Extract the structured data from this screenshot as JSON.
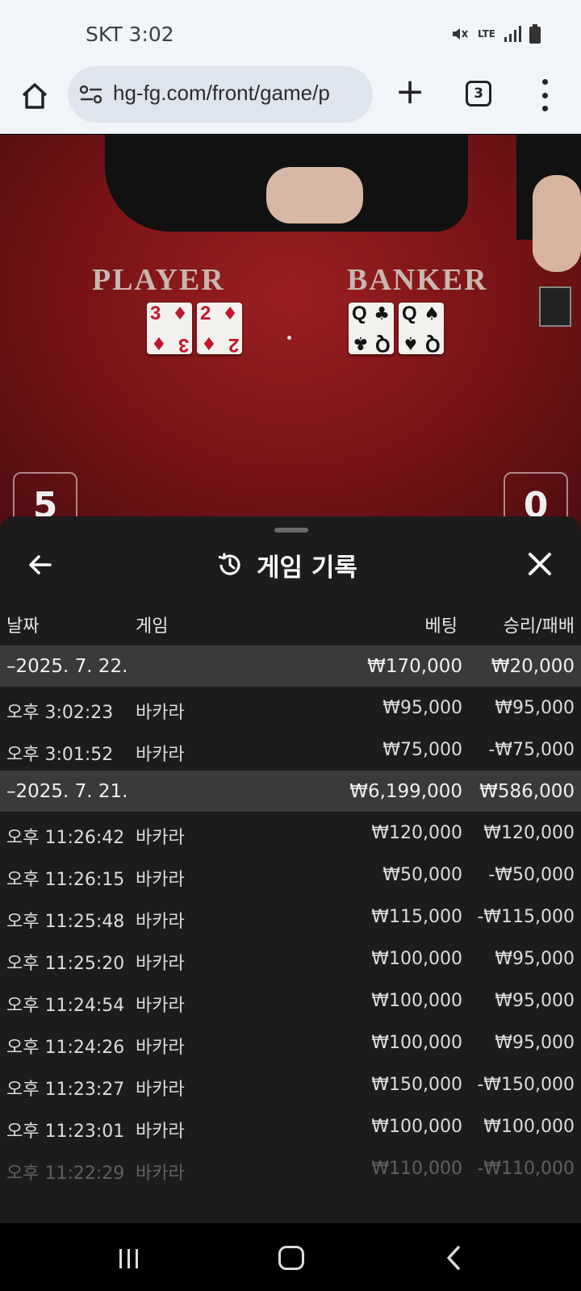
{
  "status_bar": {
    "time": "SKT 3:02",
    "icons": [
      "mute-icon",
      "lte-icon",
      "signal-icon",
      "battery-icon"
    ],
    "lte_label": "LTE"
  },
  "browser": {
    "url": "hg-fg.com/front/game/p",
    "tab_count": "3",
    "new_tab_label": "+"
  },
  "game": {
    "player_label": "PLAYER",
    "banker_label": "BANKER",
    "player_cards": [
      {
        "rank": "3",
        "suit": "♦",
        "color": "red"
      },
      {
        "rank": "2",
        "suit": "♦",
        "color": "red"
      }
    ],
    "banker_cards": [
      {
        "rank": "Q",
        "suit": "♣",
        "color": "black"
      },
      {
        "rank": "Q",
        "suit": "♠",
        "color": "black"
      }
    ],
    "player_score": "5",
    "banker_score": "0"
  },
  "history": {
    "title": "게임 기록",
    "columns": {
      "date": "날짜",
      "game": "게임",
      "bet": "베팅",
      "result": "승리/패배"
    },
    "rows": [
      {
        "type": "group",
        "date": "–2025. 7. 22.",
        "game": "",
        "bet": "₩170,000",
        "result": "₩20,000"
      },
      {
        "type": "item",
        "date": "오후 3:02:23",
        "game": "바카라",
        "bet": "₩95,000",
        "result": "₩95,000"
      },
      {
        "type": "item",
        "date": "오후 3:01:52",
        "game": "바카라",
        "bet": "₩75,000",
        "result": "-₩75,000"
      },
      {
        "type": "group",
        "date": "–2025. 7. 21.",
        "game": "",
        "bet": "₩6,199,000",
        "result": "₩586,000"
      },
      {
        "type": "item",
        "date": "오후 11:26:42",
        "game": "바카라",
        "bet": "₩120,000",
        "result": "₩120,000"
      },
      {
        "type": "item",
        "date": "오후 11:26:15",
        "game": "바카라",
        "bet": "₩50,000",
        "result": "-₩50,000"
      },
      {
        "type": "item",
        "date": "오후 11:25:48",
        "game": "바카라",
        "bet": "₩115,000",
        "result": "-₩115,000"
      },
      {
        "type": "item",
        "date": "오후 11:25:20",
        "game": "바카라",
        "bet": "₩100,000",
        "result": "₩95,000"
      },
      {
        "type": "item",
        "date": "오후 11:24:54",
        "game": "바카라",
        "bet": "₩100,000",
        "result": "₩95,000"
      },
      {
        "type": "item",
        "date": "오후 11:24:26",
        "game": "바카라",
        "bet": "₩100,000",
        "result": "₩95,000"
      },
      {
        "type": "item",
        "date": "오후 11:23:27",
        "game": "바카라",
        "bet": "₩150,000",
        "result": "-₩150,000"
      },
      {
        "type": "item",
        "date": "오후 11:23:01",
        "game": "바카라",
        "bet": "₩100,000",
        "result": "₩100,000"
      },
      {
        "type": "item",
        "date": "오후 11:22:29",
        "game": "바카라",
        "bet": "₩110,000",
        "result": "-₩110,000",
        "faded": true
      }
    ]
  },
  "nav": {
    "icons": [
      "recents-icon",
      "home-icon",
      "back-icon"
    ]
  }
}
